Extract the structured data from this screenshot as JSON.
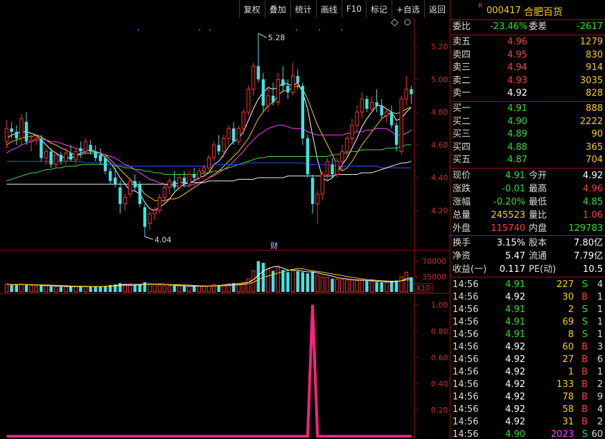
{
  "toolbar": {
    "buttons": [
      "复权",
      "叠加",
      "统计",
      "画线",
      "F10",
      "标记",
      "+自选",
      "返回"
    ]
  },
  "stock": {
    "badge": "R",
    "code": "000417",
    "name": "合肥百货"
  },
  "weibi": {
    "label1": "委比",
    "val1": "-23.46%",
    "label2": "委差",
    "val2": "-2617"
  },
  "sell": [
    {
      "label": "卖五",
      "price": "4.96",
      "vol": "1279"
    },
    {
      "label": "卖四",
      "price": "4.95",
      "vol": "830"
    },
    {
      "label": "卖三",
      "price": "4.94",
      "vol": "914"
    },
    {
      "label": "卖二",
      "price": "4.93",
      "vol": "3035"
    },
    {
      "label": "卖一",
      "price": "4.92",
      "vol": "828"
    }
  ],
  "buy": [
    {
      "label": "买一",
      "price": "4.91",
      "vol": "888"
    },
    {
      "label": "买二",
      "price": "4.90",
      "vol": "2222"
    },
    {
      "label": "买三",
      "price": "4.89",
      "vol": "90"
    },
    {
      "label": "买四",
      "price": "4.88",
      "vol": "365"
    },
    {
      "label": "买五",
      "price": "4.87",
      "vol": "704"
    }
  ],
  "quote": [
    {
      "l1": "现价",
      "v1": "4.91",
      "c1": "green",
      "l2": "今开",
      "v2": "4.92",
      "c2": "white"
    },
    {
      "l1": "涨跌",
      "v1": "-0.01",
      "c1": "green",
      "l2": "最高",
      "v2": "4.96",
      "c2": "red"
    },
    {
      "l1": "涨幅",
      "v1": "-0.20%",
      "c1": "green",
      "l2": "最低",
      "v2": "4.85",
      "c2": "green"
    },
    {
      "l1": "总量",
      "v1": "245523",
      "c1": "yellow",
      "l2": "量比",
      "v2": "1.06",
      "c2": "red"
    },
    {
      "l1": "外盘",
      "v1": "115740",
      "c1": "red",
      "l2": "内盘",
      "v2": "129783",
      "c2": "green"
    }
  ],
  "fund": [
    {
      "l1": "换手",
      "v1": "3.15%",
      "l2": "股本",
      "v2": "7.80亿"
    },
    {
      "l1": "净资",
      "v1": "5.47",
      "l2": "流通",
      "v2": "7.79亿"
    },
    {
      "l1": "收益(一)",
      "v1": "0.117",
      "l2": "PE(动)",
      "v2": "10.5"
    }
  ],
  "trades": [
    {
      "t": "14:56",
      "p": "4.91",
      "pc": "green",
      "v": "227",
      "vc": "yellow",
      "s": "S",
      "n": "4"
    },
    {
      "t": "14:56",
      "p": "4.92",
      "pc": "white",
      "v": "30",
      "vc": "yellow",
      "s": "B",
      "n": "1"
    },
    {
      "t": "14:56",
      "p": "4.91",
      "pc": "green",
      "v": "2",
      "vc": "yellow",
      "s": "S",
      "n": "1"
    },
    {
      "t": "14:56",
      "p": "4.91",
      "pc": "green",
      "v": "69",
      "vc": "yellow",
      "s": "S",
      "n": "1"
    },
    {
      "t": "14:56",
      "p": "4.91",
      "pc": "green",
      "v": "8",
      "vc": "yellow",
      "s": "S",
      "n": "1"
    },
    {
      "t": "14:56",
      "p": "4.92",
      "pc": "white",
      "v": "60",
      "vc": "yellow",
      "s": "B",
      "n": "3"
    },
    {
      "t": "14:56",
      "p": "4.92",
      "pc": "white",
      "v": "27",
      "vc": "yellow",
      "s": "B",
      "n": "6"
    },
    {
      "t": "14:56",
      "p": "4.92",
      "pc": "white",
      "v": "1",
      "vc": "yellow",
      "s": "B",
      "n": "1"
    },
    {
      "t": "14:56",
      "p": "4.92",
      "pc": "white",
      "v": "133",
      "vc": "yellow",
      "s": "B",
      "n": "2"
    },
    {
      "t": "14:56",
      "p": "4.92",
      "pc": "white",
      "v": "78",
      "vc": "yellow",
      "s": "B",
      "n": "9"
    },
    {
      "t": "14:56",
      "p": "4.92",
      "pc": "white",
      "v": "58",
      "vc": "yellow",
      "s": "B",
      "n": "4"
    },
    {
      "t": "14:56",
      "p": "4.92",
      "pc": "white",
      "v": "31",
      "vc": "yellow",
      "s": "B",
      "n": "2"
    },
    {
      "t": "14:56",
      "p": "4.90",
      "pc": "green",
      "v": "2023",
      "vc": "magenta",
      "s": "S",
      "n": "60"
    }
  ],
  "chart_data": {
    "type": "candlestick",
    "price_axis": {
      "ticks": [
        "5.20",
        "5.00",
        "4.80",
        "4.60",
        "4.40",
        "4.20"
      ],
      "ylim": [
        4.02,
        5.34
      ]
    },
    "annotations": {
      "high_label": "5.28",
      "low_label": "4.04",
      "event_marker": "财"
    },
    "candles": [
      [
        4.62,
        4.75,
        4.58,
        4.7
      ],
      [
        4.7,
        4.74,
        4.64,
        4.68
      ],
      [
        4.68,
        4.72,
        4.6,
        4.64
      ],
      [
        4.64,
        4.79,
        4.6,
        4.76
      ],
      [
        4.74,
        4.8,
        4.6,
        4.62
      ],
      [
        4.62,
        4.66,
        4.56,
        4.63
      ],
      [
        4.63,
        4.66,
        4.6,
        4.64
      ],
      [
        4.64,
        4.66,
        4.5,
        4.52
      ],
      [
        4.52,
        4.58,
        4.48,
        4.56
      ],
      [
        4.56,
        4.58,
        4.46,
        4.48
      ],
      [
        4.48,
        4.56,
        4.46,
        4.54
      ],
      [
        4.54,
        4.56,
        4.48,
        4.5
      ],
      [
        4.5,
        4.58,
        4.48,
        4.55
      ],
      [
        4.55,
        4.6,
        4.5,
        4.51
      ],
      [
        4.51,
        4.58,
        4.48,
        4.56
      ],
      [
        4.58,
        4.62,
        4.52,
        4.56
      ],
      [
        4.56,
        4.64,
        4.54,
        4.62
      ],
      [
        4.6,
        4.63,
        4.54,
        4.56
      ],
      [
        4.56,
        4.6,
        4.5,
        4.52
      ],
      [
        4.54,
        4.58,
        4.48,
        4.5
      ],
      [
        4.52,
        4.54,
        4.42,
        4.44
      ],
      [
        4.44,
        4.46,
        4.36,
        4.38
      ],
      [
        4.4,
        4.46,
        4.34,
        4.36
      ],
      [
        4.34,
        4.38,
        4.18,
        4.24
      ],
      [
        4.24,
        4.3,
        4.2,
        4.28
      ],
      [
        4.3,
        4.4,
        4.28,
        4.38
      ],
      [
        4.38,
        4.42,
        4.32,
        4.34
      ],
      [
        4.36,
        4.38,
        4.22,
        4.24
      ],
      [
        4.22,
        4.24,
        4.04,
        4.1
      ],
      [
        4.12,
        4.2,
        4.08,
        4.18
      ],
      [
        4.18,
        4.22,
        4.14,
        4.2
      ],
      [
        4.2,
        4.3,
        4.18,
        4.28
      ],
      [
        4.28,
        4.36,
        4.24,
        4.34
      ],
      [
        4.34,
        4.4,
        4.3,
        4.38
      ],
      [
        4.38,
        4.44,
        4.32,
        4.34
      ],
      [
        4.34,
        4.42,
        4.32,
        4.4
      ],
      [
        4.4,
        4.44,
        4.34,
        4.36
      ],
      [
        4.36,
        4.44,
        4.34,
        4.42
      ],
      [
        4.42,
        4.46,
        4.38,
        4.4
      ],
      [
        4.4,
        4.46,
        4.38,
        4.44
      ],
      [
        4.44,
        4.48,
        4.4,
        4.46
      ],
      [
        4.46,
        4.54,
        4.44,
        4.52
      ],
      [
        4.52,
        4.62,
        4.5,
        4.6
      ],
      [
        4.6,
        4.66,
        4.54,
        4.56
      ],
      [
        4.56,
        4.66,
        4.52,
        4.64
      ],
      [
        4.64,
        4.72,
        4.6,
        4.7
      ],
      [
        4.7,
        4.74,
        4.6,
        4.62
      ],
      [
        4.62,
        4.72,
        4.6,
        4.7
      ],
      [
        4.7,
        4.82,
        4.66,
        4.8
      ],
      [
        4.8,
        4.96,
        4.78,
        4.94
      ],
      [
        4.94,
        5.1,
        4.9,
        5.08
      ],
      [
        5.08,
        5.28,
        4.98,
        5.0
      ],
      [
        5.0,
        5.04,
        4.8,
        4.84
      ],
      [
        4.84,
        4.96,
        4.8,
        4.9
      ],
      [
        4.9,
        4.98,
        4.84,
        4.86
      ],
      [
        4.86,
        5.04,
        4.84,
        5.0
      ],
      [
        5.0,
        5.08,
        4.92,
        4.96
      ],
      [
        4.96,
        5.0,
        4.88,
        4.92
      ],
      [
        4.92,
        5.1,
        4.9,
        5.02
      ],
      [
        5.02,
        5.06,
        4.94,
        4.98
      ],
      [
        4.96,
        4.98,
        4.6,
        4.64
      ],
      [
        4.64,
        4.66,
        4.4,
        4.42
      ],
      [
        4.4,
        4.42,
        4.18,
        4.24
      ],
      [
        4.24,
        4.32,
        4.12,
        4.3
      ],
      [
        4.3,
        4.44,
        4.26,
        4.42
      ],
      [
        4.42,
        4.52,
        4.38,
        4.5
      ],
      [
        4.48,
        4.52,
        4.4,
        4.42
      ],
      [
        4.42,
        4.52,
        4.4,
        4.5
      ],
      [
        4.5,
        4.6,
        4.44,
        4.56
      ],
      [
        4.56,
        4.66,
        4.52,
        4.64
      ],
      [
        4.64,
        4.76,
        4.6,
        4.72
      ],
      [
        4.72,
        4.84,
        4.68,
        4.8
      ],
      [
        4.8,
        4.92,
        4.76,
        4.88
      ],
      [
        4.88,
        4.9,
        4.8,
        4.82
      ],
      [
        4.82,
        4.9,
        4.8,
        4.86
      ],
      [
        4.86,
        4.94,
        4.8,
        4.84
      ],
      [
        4.84,
        4.88,
        4.76,
        4.78
      ],
      [
        4.78,
        4.82,
        4.74,
        4.8
      ],
      [
        4.8,
        4.84,
        4.7,
        4.72
      ],
      [
        4.72,
        4.74,
        4.56,
        4.6
      ],
      [
        4.56,
        4.9,
        4.54,
        4.88
      ],
      [
        4.88,
        5.02,
        4.84,
        4.94
      ],
      [
        4.94,
        4.96,
        4.85,
        4.91
      ]
    ],
    "ma_lines": [
      {
        "color": "#ffffff",
        "values": [
          4.64,
          4.66,
          4.67,
          4.68,
          4.68,
          4.67,
          4.66,
          4.63,
          4.6,
          4.57,
          4.55,
          4.53,
          4.52,
          4.52,
          4.53,
          4.55,
          4.56,
          4.57,
          4.56,
          4.55,
          4.52,
          4.49,
          4.45,
          4.4,
          4.36,
          4.32,
          4.32,
          4.3,
          4.25,
          4.21,
          4.2,
          4.22,
          4.24,
          4.27,
          4.31,
          4.34,
          4.36,
          4.37,
          4.38,
          4.4,
          4.41,
          4.43,
          4.48,
          4.5,
          4.54,
          4.59,
          4.62,
          4.64,
          4.68,
          4.75,
          4.82,
          4.88,
          4.92,
          4.95,
          4.94,
          4.95,
          4.98,
          4.97,
          4.96,
          4.98,
          4.92,
          4.82,
          4.66,
          4.51,
          4.4,
          4.38,
          4.4,
          4.43,
          4.48,
          4.52,
          4.58,
          4.64,
          4.71,
          4.76,
          4.8,
          4.84,
          4.84,
          4.82,
          4.8,
          4.75,
          4.76,
          4.8,
          4.83
        ]
      },
      {
        "color": "#ffd000",
        "values": [
          4.6,
          4.62,
          4.63,
          4.64,
          4.65,
          4.65,
          4.66,
          4.65,
          4.63,
          4.61,
          4.6,
          4.58,
          4.57,
          4.55,
          4.54,
          4.54,
          4.55,
          4.55,
          4.55,
          4.55,
          4.54,
          4.51,
          4.48,
          4.45,
          4.42,
          4.39,
          4.36,
          4.34,
          4.3,
          4.28,
          4.26,
          4.26,
          4.26,
          4.27,
          4.27,
          4.28,
          4.3,
          4.32,
          4.34,
          4.36,
          4.38,
          4.4,
          4.42,
          4.44,
          4.47,
          4.5,
          4.53,
          4.56,
          4.6,
          4.64,
          4.7,
          4.76,
          4.8,
          4.84,
          4.86,
          4.9,
          4.93,
          4.93,
          4.95,
          4.96,
          4.94,
          4.88,
          4.8,
          4.72,
          4.66,
          4.6,
          4.54,
          4.48,
          4.44,
          4.46,
          4.5,
          4.55,
          4.6,
          4.64,
          4.68,
          4.72,
          4.76,
          4.78,
          4.8,
          4.79,
          4.8,
          4.82,
          4.83
        ]
      },
      {
        "color": "#ff40ff",
        "values": [
          4.55,
          4.57,
          4.58,
          4.6,
          4.61,
          4.62,
          4.63,
          4.63,
          4.63,
          4.62,
          4.62,
          4.61,
          4.6,
          4.59,
          4.58,
          4.57,
          4.57,
          4.56,
          4.56,
          4.55,
          4.54,
          4.53,
          4.52,
          4.5,
          4.48,
          4.47,
          4.45,
          4.43,
          4.41,
          4.39,
          4.38,
          4.37,
          4.36,
          4.35,
          4.35,
          4.35,
          4.35,
          4.35,
          4.36,
          4.37,
          4.38,
          4.4,
          4.41,
          4.43,
          4.45,
          4.47,
          4.5,
          4.53,
          4.56,
          4.6,
          4.63,
          4.66,
          4.68,
          4.7,
          4.71,
          4.72,
          4.72,
          4.71,
          4.7,
          4.7,
          4.7,
          4.68,
          4.67,
          4.66,
          4.66,
          4.66,
          4.66,
          4.66,
          4.66,
          4.67,
          4.67,
          4.68,
          4.68,
          4.69,
          4.69,
          4.7,
          4.7,
          4.7,
          4.68,
          4.66,
          4.66,
          4.67,
          4.69
        ]
      },
      {
        "color": "#40e040",
        "values": [
          4.38,
          4.39,
          4.4,
          4.41,
          4.42,
          4.43,
          4.43,
          4.44,
          4.45,
          4.45,
          4.46,
          4.46,
          4.47,
          4.47,
          4.47,
          4.48,
          4.48,
          4.48,
          4.48,
          4.48,
          4.48,
          4.48,
          4.47,
          4.47,
          4.46,
          4.46,
          4.45,
          4.45,
          4.44,
          4.44,
          4.43,
          4.43,
          4.42,
          4.42,
          4.42,
          4.42,
          4.42,
          4.42,
          4.42,
          4.42,
          4.43,
          4.43,
          4.44,
          4.44,
          4.45,
          4.46,
          4.47,
          4.48,
          4.49,
          4.5,
          4.51,
          4.52,
          4.52,
          4.53,
          4.53,
          4.53,
          4.53,
          4.53,
          4.53,
          4.53,
          4.53,
          4.53,
          4.53,
          4.53,
          4.53,
          4.53,
          4.54,
          4.54,
          4.55,
          4.55,
          4.56,
          4.56,
          4.57,
          4.57,
          4.57,
          4.57,
          4.57,
          4.58,
          4.58,
          4.58,
          4.59,
          4.6,
          4.6
        ]
      },
      {
        "color": "#3050ff",
        "values": [
          4.5,
          4.5,
          4.5,
          4.5,
          4.5,
          4.5,
          4.5,
          4.5,
          4.5,
          4.5,
          4.5,
          4.5,
          4.5,
          4.5,
          4.5,
          4.5,
          4.49,
          4.49,
          4.49,
          4.49,
          4.48,
          4.48,
          4.48,
          4.48,
          4.47,
          4.47,
          4.47,
          4.47,
          4.47,
          4.47,
          4.47,
          4.47,
          4.47,
          4.47,
          4.47,
          4.47,
          4.47,
          4.47,
          4.47,
          4.47,
          4.47,
          4.47,
          4.48,
          4.48,
          4.48,
          4.48,
          4.48,
          4.48,
          4.48,
          4.49,
          4.49,
          4.49,
          4.49,
          4.49,
          4.49,
          4.49,
          4.49,
          4.49,
          4.49,
          4.49,
          4.49,
          4.48,
          4.48,
          4.48,
          4.48,
          4.48,
          4.48,
          4.47,
          4.47,
          4.47,
          4.47,
          4.47,
          4.47,
          4.47,
          4.47,
          4.47,
          4.46,
          4.46,
          4.46,
          4.46,
          4.46,
          4.46,
          4.46
        ]
      },
      {
        "color": "#f0f0f0",
        "values": [
          4.36,
          4.36,
          4.36,
          4.36,
          4.36,
          4.36,
          4.36,
          4.36,
          4.36,
          4.36,
          4.36,
          4.36,
          4.36,
          4.36,
          4.36,
          4.36,
          4.36,
          4.36,
          4.36,
          4.36,
          4.36,
          4.36,
          4.36,
          4.36,
          4.36,
          4.36,
          4.36,
          4.36,
          4.36,
          4.36,
          4.36,
          4.36,
          4.36,
          4.36,
          4.36,
          4.37,
          4.37,
          4.37,
          4.37,
          4.37,
          4.37,
          4.38,
          4.38,
          4.38,
          4.38,
          4.38,
          4.38,
          4.39,
          4.39,
          4.39,
          4.39,
          4.4,
          4.4,
          4.4,
          4.4,
          4.4,
          4.4,
          4.41,
          4.41,
          4.41,
          4.41,
          4.41,
          4.41,
          4.41,
          4.41,
          4.41,
          4.41,
          4.42,
          4.42,
          4.42,
          4.42,
          4.42,
          4.43,
          4.43,
          4.43,
          4.44,
          4.45,
          4.46,
          4.47,
          4.48,
          4.49,
          4.49,
          4.5
        ]
      }
    ],
    "volume_axis": {
      "ticks": [
        "70000",
        "35000"
      ],
      "unit": "X10",
      "ymax": 85000
    },
    "volume": [
      18,
      16,
      17,
      18,
      16,
      15,
      14,
      15,
      14,
      13,
      13,
      12,
      12,
      12,
      13,
      13,
      12,
      12,
      12,
      13,
      14,
      16,
      17,
      20,
      18,
      16,
      15,
      17,
      22,
      19,
      17,
      16,
      15,
      14,
      14,
      14,
      13,
      13,
      13,
      13,
      13,
      14,
      17,
      16,
      17,
      19,
      20,
      19,
      22,
      30,
      48,
      70,
      66,
      52,
      48,
      55,
      50,
      45,
      49,
      47,
      45,
      42,
      45,
      38,
      34,
      33,
      30,
      29,
      28,
      27,
      27,
      26,
      26,
      25,
      24,
      23,
      22,
      22,
      24,
      26,
      34,
      45,
      33
    ],
    "indicator_axis": {
      "ticks": [
        "1.00",
        "0.80",
        "0.60",
        "0.40",
        "0.20"
      ],
      "ylim": [
        0,
        1.05
      ]
    },
    "indicator": {
      "color": "#ff2080",
      "spike_index": 62,
      "spike_value": 1.0,
      "base_value": 0.0
    }
  }
}
